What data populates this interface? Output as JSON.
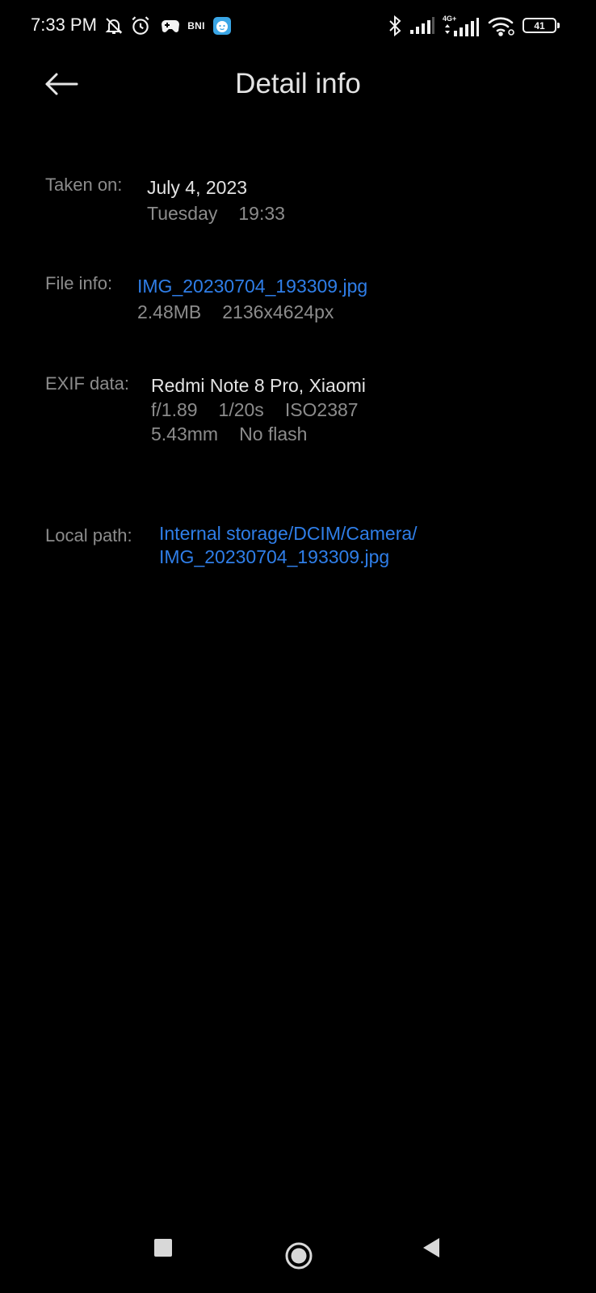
{
  "status_bar": {
    "time": "7:33 PM",
    "bni_label": "BNI",
    "network_label": "4G+",
    "battery_level": "41",
    "icons": [
      "silent-bell-icon",
      "alarm-icon",
      "game-controller-icon",
      "bni-app-icon",
      "baby-face-app-icon",
      "bluetooth-icon",
      "signal-icon",
      "signal-4g-icon",
      "wifi-icon",
      "battery-icon"
    ]
  },
  "header": {
    "title": "Detail info",
    "back_icon": "arrow-left-icon"
  },
  "taken_on": {
    "label": "Taken on:",
    "date": "July 4, 2023",
    "weekday": "Tuesday",
    "time": "19:33"
  },
  "file_info": {
    "label": "File info:",
    "filename": "IMG_20230704_193309.jpg",
    "size": "2.48MB",
    "resolution": "2136x4624px"
  },
  "exif": {
    "label": "EXIF data:",
    "device": "Redmi Note 8 Pro, Xiaomi",
    "aperture": "f/1.89",
    "shutter": "1/20s",
    "iso": "ISO2387",
    "focal_length": "5.43mm",
    "flash": "No flash"
  },
  "local_path": {
    "label": "Local path:",
    "line1": "Internal storage/DCIM/Camera/",
    "line2": "IMG_20230704_193309.jpg"
  },
  "nav_bar": {
    "icons": [
      "recents-square-icon",
      "home-circle-icon",
      "back-triangle-icon"
    ]
  },
  "colors": {
    "background": "#000000",
    "primary_text": "#e3e3e3",
    "secondary_text": "#8c8c8c",
    "link": "#2f7ee8"
  }
}
